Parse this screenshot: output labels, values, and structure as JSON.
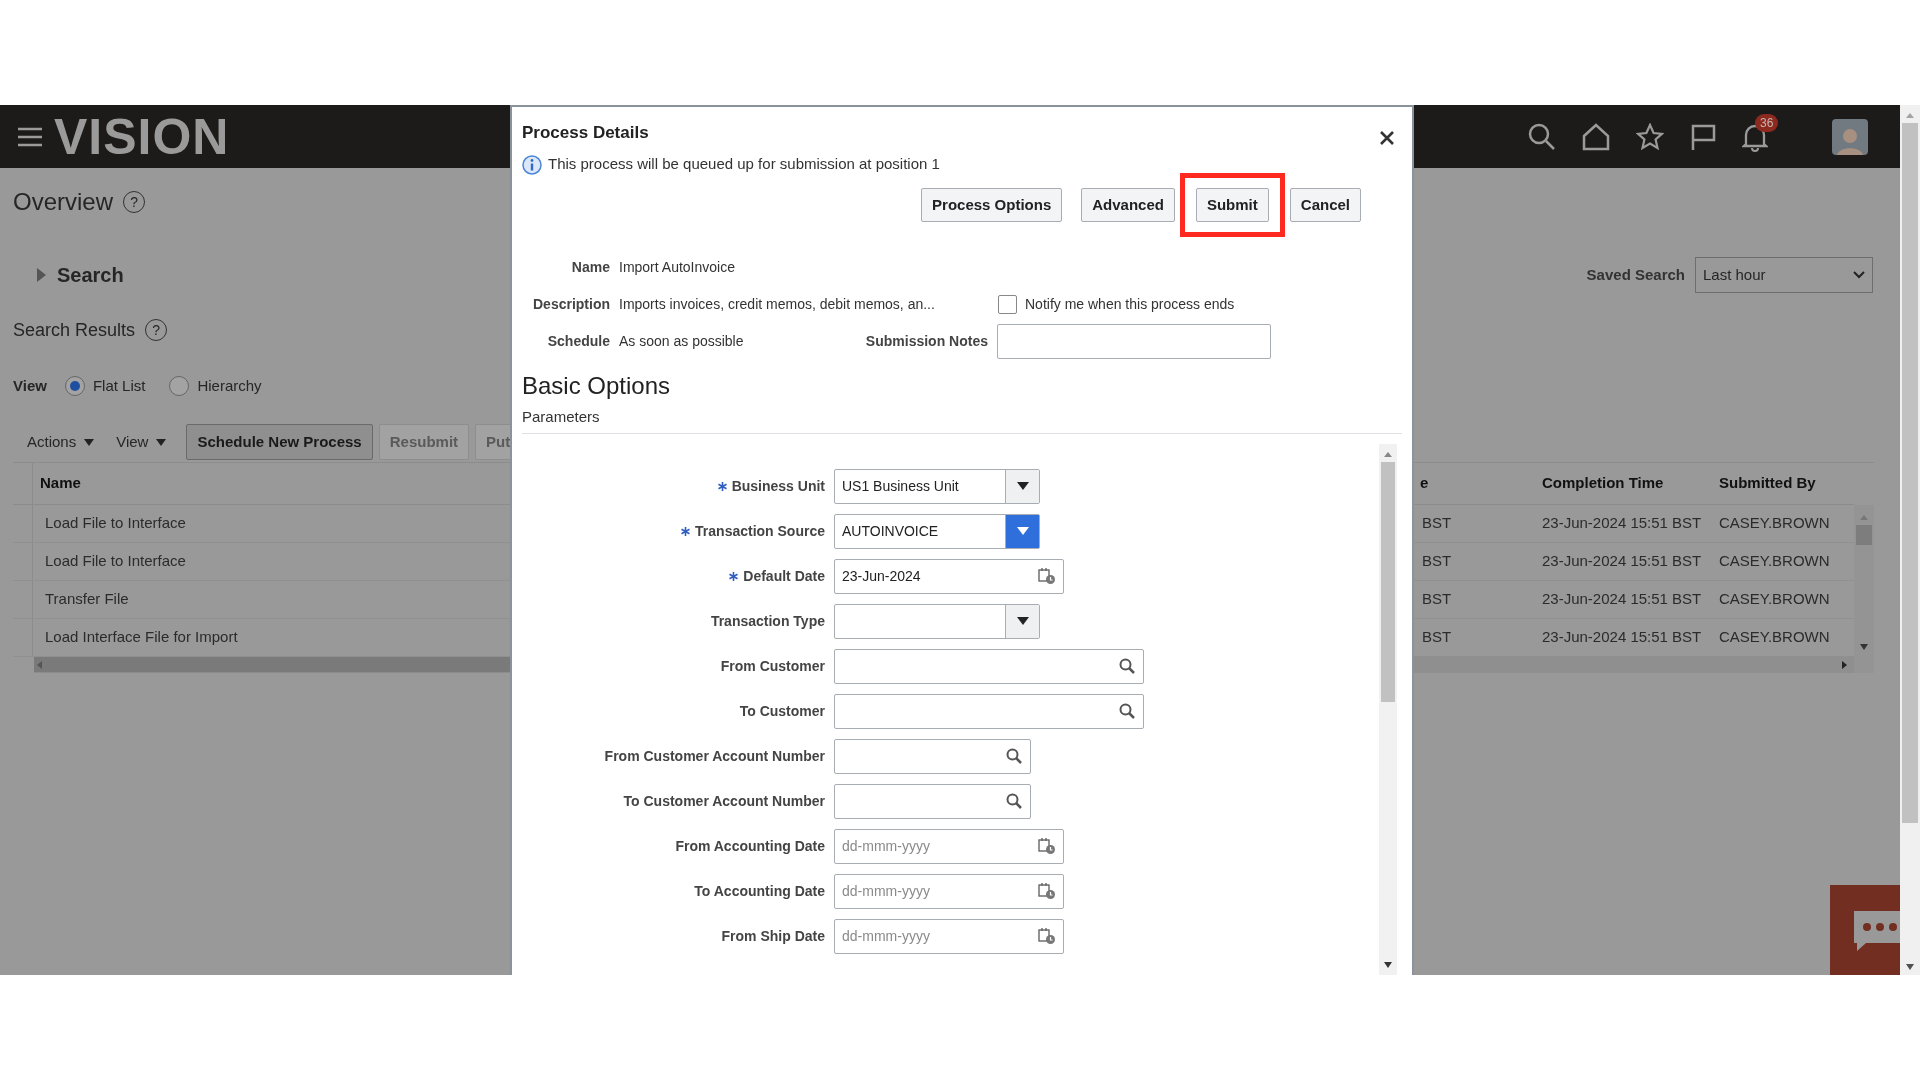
{
  "app": {
    "logo": "VISION",
    "notification_count": "36"
  },
  "page": {
    "title": "Overview",
    "title_help": "?",
    "results_help": "?",
    "search": {
      "label": "Search",
      "expanded": false
    },
    "results_title": "Search Results",
    "view_label": "View",
    "view_options": [
      {
        "label": "Flat List",
        "selected": true
      },
      {
        "label": "Hierarchy",
        "selected": false
      }
    ],
    "toolbar": [
      {
        "kind": "menu",
        "label": "Actions"
      },
      {
        "kind": "menu",
        "label": "View"
      },
      {
        "kind": "button",
        "label": "Schedule New Process",
        "disabled": false
      },
      {
        "kind": "button",
        "label": "Resubmit",
        "disabled": true
      },
      {
        "kind": "button",
        "label": "Put",
        "disabled": true
      }
    ],
    "saved_search": {
      "label": "Saved Search",
      "value": "Last hour"
    }
  },
  "table": {
    "columns": [
      "Name",
      "e",
      "Completion Time",
      "Submitted By"
    ],
    "rows": [
      [
        "Load File to Interface",
        "BST",
        "23-Jun-2024 15:51 BST",
        "CASEY.BROWN"
      ],
      [
        "Load File to Interface",
        "BST",
        "23-Jun-2024 15:51 BST",
        "CASEY.BROWN"
      ],
      [
        "Transfer File",
        "BST",
        "23-Jun-2024 15:51 BST",
        "CASEY.BROWN"
      ],
      [
        "Load Interface File for Import",
        "BST",
        "23-Jun-2024 15:51 BST",
        "CASEY.BROWN"
      ]
    ]
  },
  "dialog": {
    "title": "Process Details",
    "info": "This process will be queued up for submission at position 1",
    "buttons": [
      {
        "label": "Process Options",
        "highlighted": false
      },
      {
        "label": "Advanced",
        "highlighted": false
      },
      {
        "label": "Submit",
        "highlighted": true
      },
      {
        "label": "Cancel",
        "highlighted": false
      }
    ],
    "details": [
      {
        "label": "Name",
        "value": "Import AutoInvoice"
      },
      {
        "label": "Description",
        "value": "Imports invoices, credit memos, debit memos, an..."
      },
      {
        "label": "Schedule",
        "value": "As soon as possible"
      }
    ],
    "notify": {
      "label": "Notify me when this process ends",
      "checked": false
    },
    "submission_notes": {
      "label": "Submission Notes"
    },
    "section_title": "Basic Options",
    "subsection": "Parameters",
    "parameters": [
      {
        "label": "Business Unit",
        "kind": "select",
        "required": true,
        "value": "US1 Business Unit",
        "focused": false
      },
      {
        "label": "Transaction Source",
        "kind": "select",
        "required": true,
        "value": "AUTOINVOICE",
        "focused": true
      },
      {
        "label": "Default Date",
        "kind": "date",
        "required": true,
        "value": "23-Jun-2024"
      },
      {
        "label": "Transaction Type",
        "kind": "select",
        "required": false,
        "focused": false
      },
      {
        "label": "From Customer",
        "kind": "lookup",
        "required": false,
        "wide": true
      },
      {
        "label": "To Customer",
        "kind": "lookup",
        "required": false,
        "wide": true
      },
      {
        "label": "From Customer Account Number",
        "kind": "lookup",
        "required": false,
        "wide": false
      },
      {
        "label": "To Customer Account Number",
        "kind": "lookup",
        "required": false,
        "wide": false
      },
      {
        "label": "From Accounting Date",
        "kind": "date",
        "required": false,
        "placeholder": "dd-mmm-yyyy"
      },
      {
        "label": "To Accounting Date",
        "kind": "date",
        "required": false,
        "placeholder": "dd-mmm-yyyy"
      },
      {
        "label": "From Ship Date",
        "kind": "date",
        "required": false,
        "placeholder": "dd-mmm-yyyy"
      }
    ]
  }
}
